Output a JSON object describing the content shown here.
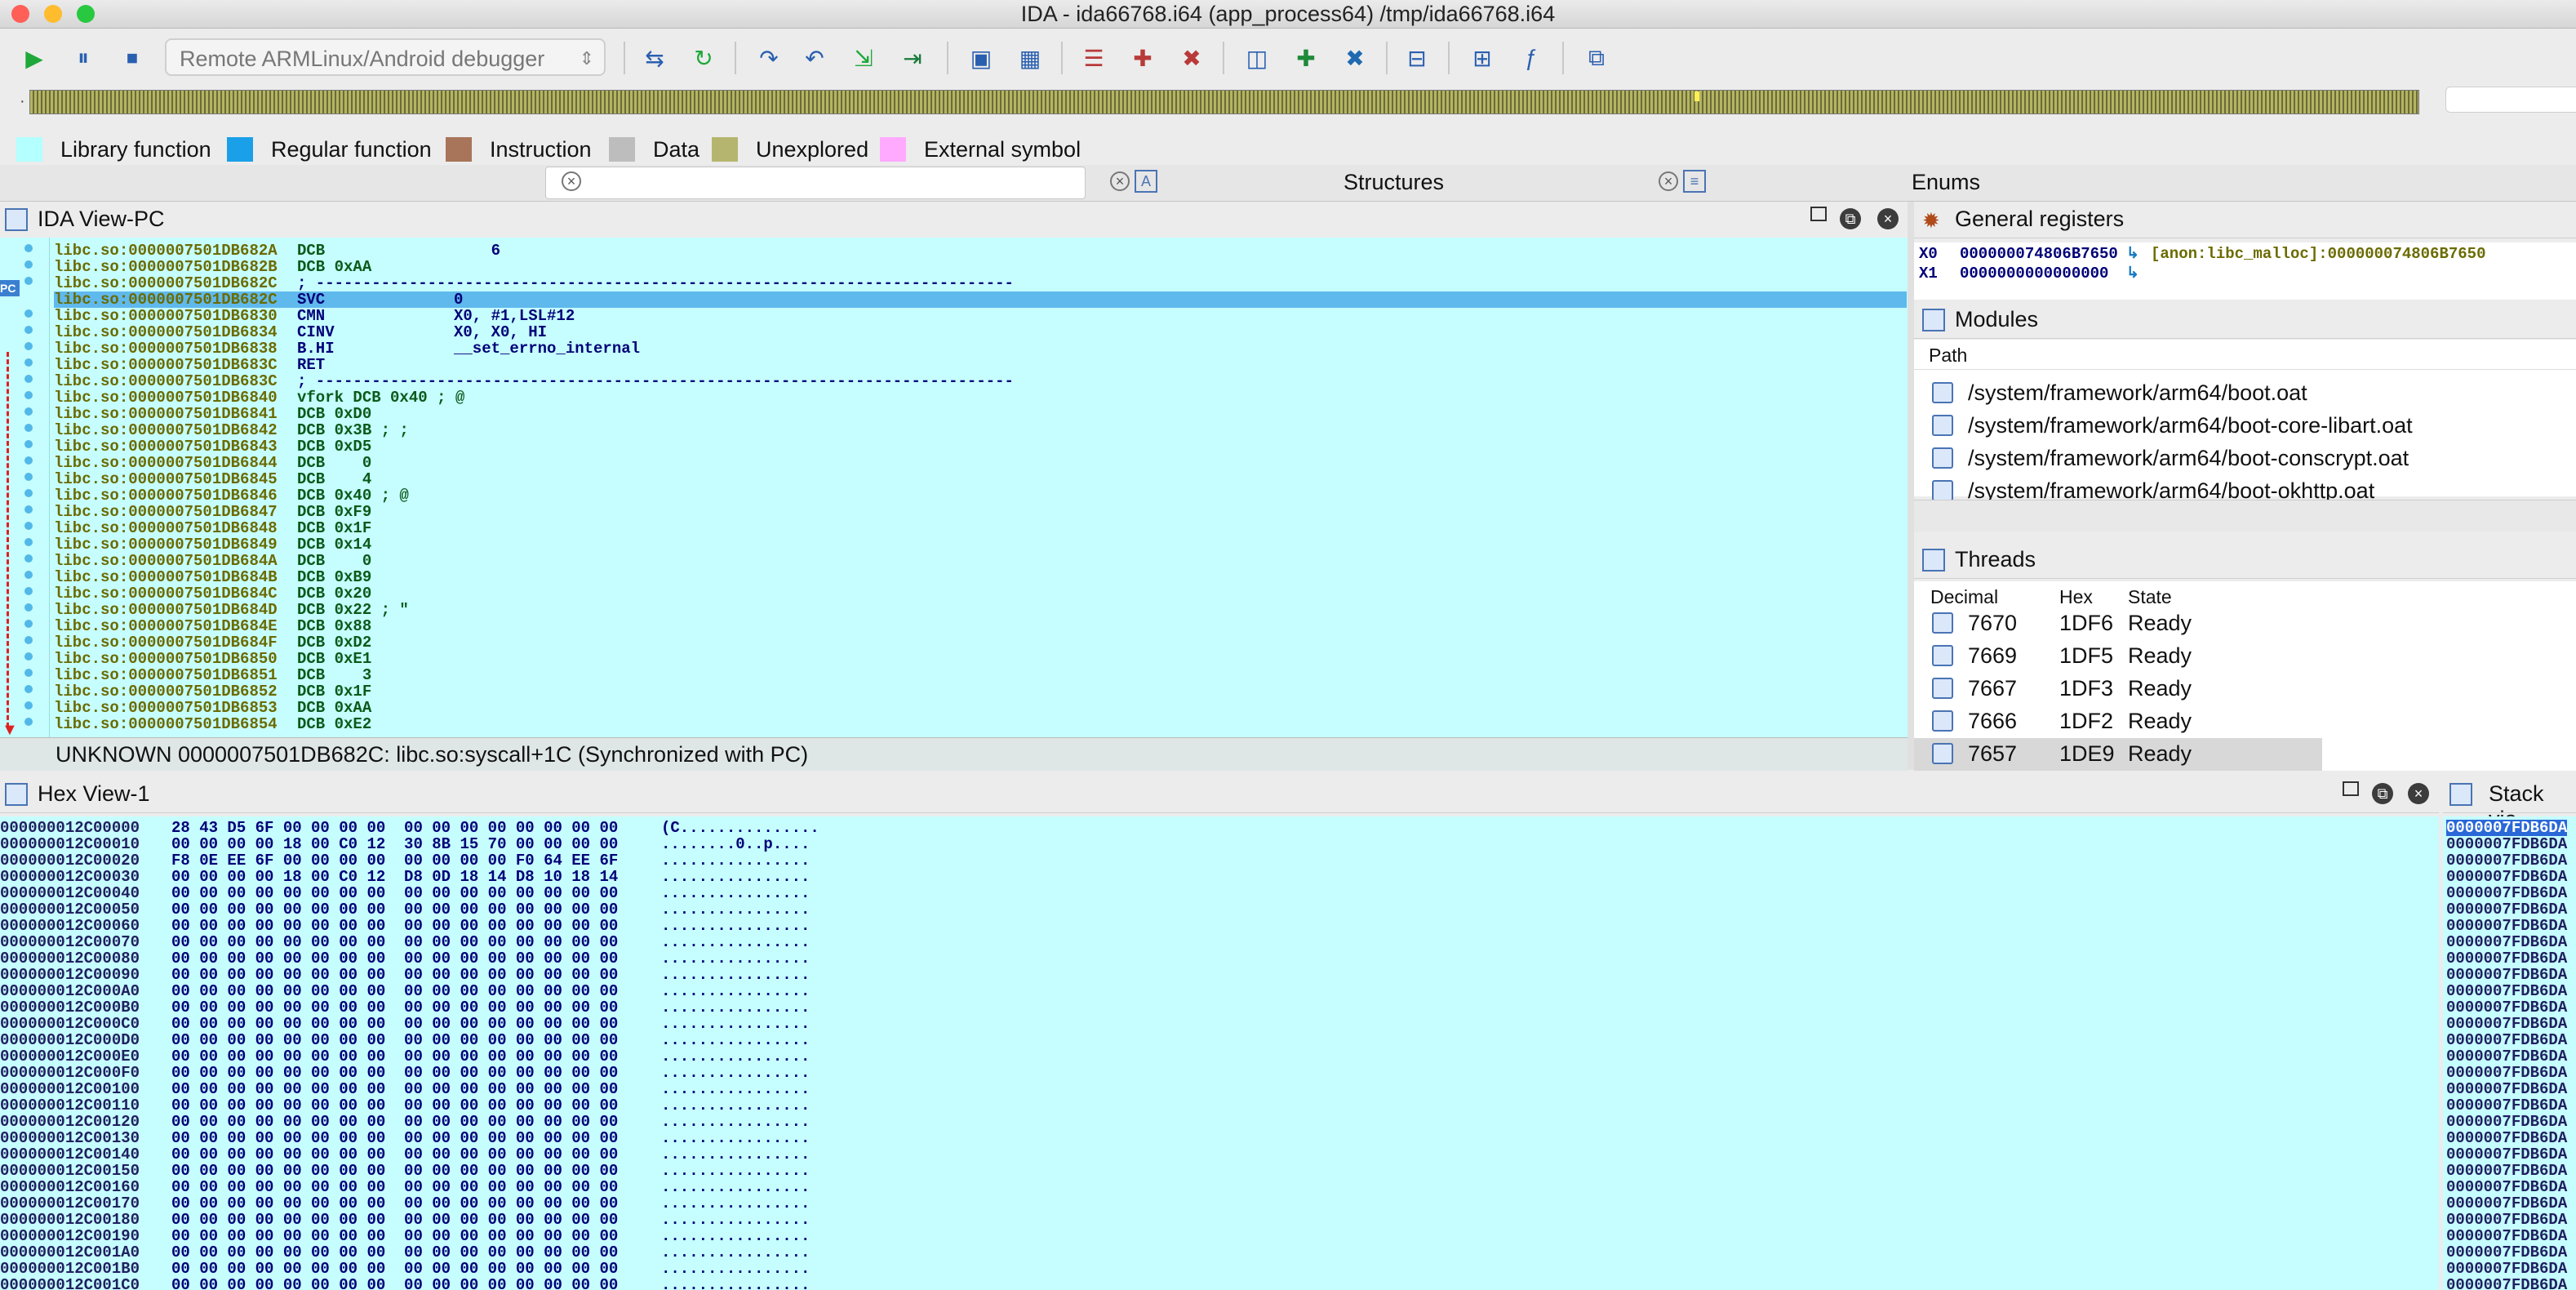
{
  "window": {
    "title": "IDA - ida66768.i64 (app_process64) /tmp/ida66768.i64"
  },
  "toolbar": {
    "debugger": "Remote ARMLinux/Android debugger",
    "icons": [
      "play-icon",
      "pause-icon",
      "stop-icon",
      "attach-icon",
      "step-into-icon",
      "step-over-icon",
      "step-out-icon",
      "run-to-cursor-icon",
      "breakpoint-icon",
      "add-watch-icon",
      "delete-watch-icon",
      "view-icon",
      "regs-icon",
      "list-icon",
      "trace-icon",
      "struct-icon",
      "func-icon",
      "window-icon"
    ]
  },
  "legend": [
    {
      "label": "Library function",
      "color": "#b4ffff"
    },
    {
      "label": "Regular function",
      "color": "#1aa0e8"
    },
    {
      "label": "Instruction",
      "color": "#a8745a"
    },
    {
      "label": "Data",
      "color": "#bdbdbd"
    },
    {
      "label": "Unexplored",
      "color": "#b5b56f"
    },
    {
      "label": "External symbol",
      "color": "#ffaaff"
    }
  ],
  "tabs": {
    "structures": "Structures",
    "enums": "Enums"
  },
  "ida_view": {
    "title": "IDA View-PC",
    "pc_label": "PC",
    "lines": [
      {
        "addr": "libc.so:0000007501DB682A",
        "mn": "DCB",
        "op": "    6"
      },
      {
        "addr": "libc.so:0000007501DB682B",
        "mn": "DCB 0xAA",
        "op": ""
      },
      {
        "addr": "libc.so:0000007501DB682C",
        "mn": "; ---------------------------------------------------------------------------",
        "op": ""
      },
      {
        "addr": "libc.so:0000007501DB682C",
        "mn": "SVC",
        "op": "0",
        "hl": true
      },
      {
        "addr": "libc.so:0000007501DB6830",
        "mn": "CMN",
        "op": "X0, #1,LSL#12"
      },
      {
        "addr": "libc.so:0000007501DB6834",
        "mn": "CINV",
        "op": "X0, X0, HI"
      },
      {
        "addr": "libc.so:0000007501DB6838",
        "mn": "B.HI",
        "op": "__set_errno_internal"
      },
      {
        "addr": "libc.so:0000007501DB683C",
        "mn": "RET",
        "op": ""
      },
      {
        "addr": "libc.so:0000007501DB683C",
        "mn": "; ---------------------------------------------------------------------------",
        "op": ""
      },
      {
        "addr": "libc.so:0000007501DB6840",
        "mn": "vfork DCB 0x40 ; @",
        "op": ""
      },
      {
        "addr": "libc.so:0000007501DB6841",
        "mn": "DCB 0xD0",
        "op": ""
      },
      {
        "addr": "libc.so:0000007501DB6842",
        "mn": "DCB 0x3B ; ;",
        "op": ""
      },
      {
        "addr": "libc.so:0000007501DB6843",
        "mn": "DCB 0xD5",
        "op": ""
      },
      {
        "addr": "libc.so:0000007501DB6844",
        "mn": "DCB    0",
        "op": ""
      },
      {
        "addr": "libc.so:0000007501DB6845",
        "mn": "DCB    4",
        "op": ""
      },
      {
        "addr": "libc.so:0000007501DB6846",
        "mn": "DCB 0x40 ; @",
        "op": ""
      },
      {
        "addr": "libc.so:0000007501DB6847",
        "mn": "DCB 0xF9",
        "op": ""
      },
      {
        "addr": "libc.so:0000007501DB6848",
        "mn": "DCB 0x1F",
        "op": ""
      },
      {
        "addr": "libc.so:0000007501DB6849",
        "mn": "DCB 0x14",
        "op": ""
      },
      {
        "addr": "libc.so:0000007501DB684A",
        "mn": "DCB    0",
        "op": ""
      },
      {
        "addr": "libc.so:0000007501DB684B",
        "mn": "DCB 0xB9",
        "op": ""
      },
      {
        "addr": "libc.so:0000007501DB684C",
        "mn": "DCB 0x20",
        "op": ""
      },
      {
        "addr": "libc.so:0000007501DB684D",
        "mn": "DCB 0x22 ; \"",
        "op": ""
      },
      {
        "addr": "libc.so:0000007501DB684E",
        "mn": "DCB 0x88",
        "op": ""
      },
      {
        "addr": "libc.so:0000007501DB684F",
        "mn": "DCB 0xD2",
        "op": ""
      },
      {
        "addr": "libc.so:0000007501DB6850",
        "mn": "DCB 0xE1",
        "op": ""
      },
      {
        "addr": "libc.so:0000007501DB6851",
        "mn": "DCB    3",
        "op": ""
      },
      {
        "addr": "libc.so:0000007501DB6852",
        "mn": "DCB 0x1F",
        "op": ""
      },
      {
        "addr": "libc.so:0000007501DB6853",
        "mn": "DCB 0xAA",
        "op": ""
      },
      {
        "addr": "libc.so:0000007501DB6854",
        "mn": "DCB 0xE2",
        "op": ""
      }
    ],
    "status": "UNKNOWN  0000007501DB682C: libc.so:syscall+1C  (Synchronized with PC)"
  },
  "registers": {
    "title": "General registers",
    "rows": [
      {
        "name": "X0",
        "value": "000000074806B7650",
        "note": "[anon:libc_malloc]:000000074806B7650"
      },
      {
        "name": "X1",
        "value": "0000000000000000",
        "note": ""
      }
    ]
  },
  "modules": {
    "title": "Modules",
    "column": "Path",
    "rows": [
      "/system/framework/arm64/boot.oat",
      "/system/framework/arm64/boot-core-libart.oat",
      "/system/framework/arm64/boot-conscrypt.oat",
      "/system/framework/arm64/boot-okhttp.oat"
    ]
  },
  "threads": {
    "title": "Threads",
    "columns": [
      "Decimal",
      "Hex",
      "State"
    ],
    "rows": [
      [
        "7670",
        "1DF6",
        "Ready"
      ],
      [
        "7669",
        "1DF5",
        "Ready"
      ],
      [
        "7667",
        "1DF3",
        "Ready"
      ],
      [
        "7666",
        "1DF2",
        "Ready"
      ],
      [
        "7657",
        "1DE9",
        "Ready"
      ]
    ]
  },
  "hex_view": {
    "title": "Hex View-1",
    "rows": [
      [
        "000000012C00000",
        "28 43 D5 6F 00 00 00 00  00 00 00 00 00 00 00 00",
        "(C..............."
      ],
      [
        "000000012C00010",
        "00 00 00 00 18 00 C0 12  30 8B 15 70 00 00 00 00",
        "........0..p...."
      ],
      [
        "000000012C00020",
        "F8 0E EE 6F 00 00 00 00  00 00 00 00 F0 64 EE 6F",
        "................"
      ],
      [
        "000000012C00030",
        "00 00 00 00 18 00 C0 12  D8 0D 18 14 D8 10 18 14",
        "................"
      ],
      [
        "000000012C00040",
        "00 00 00 00 00 00 00 00  00 00 00 00 00 00 00 00",
        "................"
      ],
      [
        "000000012C00050",
        "00 00 00 00 00 00 00 00  00 00 00 00 00 00 00 00",
        "................"
      ],
      [
        "000000012C00060",
        "00 00 00 00 00 00 00 00  00 00 00 00 00 00 00 00",
        "................"
      ],
      [
        "000000012C00070",
        "00 00 00 00 00 00 00 00  00 00 00 00 00 00 00 00",
        "................"
      ],
      [
        "000000012C00080",
        "00 00 00 00 00 00 00 00  00 00 00 00 00 00 00 00",
        "................"
      ],
      [
        "000000012C00090",
        "00 00 00 00 00 00 00 00  00 00 00 00 00 00 00 00",
        "................"
      ],
      [
        "000000012C000A0",
        "00 00 00 00 00 00 00 00  00 00 00 00 00 00 00 00",
        "................"
      ],
      [
        "000000012C000B0",
        "00 00 00 00 00 00 00 00  00 00 00 00 00 00 00 00",
        "................"
      ],
      [
        "000000012C000C0",
        "00 00 00 00 00 00 00 00  00 00 00 00 00 00 00 00",
        "................"
      ],
      [
        "000000012C000D0",
        "00 00 00 00 00 00 00 00  00 00 00 00 00 00 00 00",
        "................"
      ],
      [
        "000000012C000E0",
        "00 00 00 00 00 00 00 00  00 00 00 00 00 00 00 00",
        "................"
      ],
      [
        "000000012C000F0",
        "00 00 00 00 00 00 00 00  00 00 00 00 00 00 00 00",
        "................"
      ],
      [
        "000000012C00100",
        "00 00 00 00 00 00 00 00  00 00 00 00 00 00 00 00",
        "................"
      ],
      [
        "000000012C00110",
        "00 00 00 00 00 00 00 00  00 00 00 00 00 00 00 00",
        "................"
      ],
      [
        "000000012C00120",
        "00 00 00 00 00 00 00 00  00 00 00 00 00 00 00 00",
        "................"
      ],
      [
        "000000012C00130",
        "00 00 00 00 00 00 00 00  00 00 00 00 00 00 00 00",
        "................"
      ],
      [
        "000000012C00140",
        "00 00 00 00 00 00 00 00  00 00 00 00 00 00 00 00",
        "................"
      ],
      [
        "000000012C00150",
        "00 00 00 00 00 00 00 00  00 00 00 00 00 00 00 00",
        "................"
      ],
      [
        "000000012C00160",
        "00 00 00 00 00 00 00 00  00 00 00 00 00 00 00 00",
        "................"
      ],
      [
        "000000012C00170",
        "00 00 00 00 00 00 00 00  00 00 00 00 00 00 00 00",
        "................"
      ],
      [
        "000000012C00180",
        "00 00 00 00 00 00 00 00  00 00 00 00 00 00 00 00",
        "................"
      ],
      [
        "000000012C00190",
        "00 00 00 00 00 00 00 00  00 00 00 00 00 00 00 00",
        "................"
      ],
      [
        "000000012C001A0",
        "00 00 00 00 00 00 00 00  00 00 00 00 00 00 00 00",
        "................"
      ],
      [
        "000000012C001B0",
        "00 00 00 00 00 00 00 00  00 00 00 00 00 00 00 00",
        "................"
      ],
      [
        "000000012C001C0",
        "00 00 00 00 00 00 00 00  00 00 00 00 00 00 00 00",
        "................"
      ]
    ]
  },
  "stack_view": {
    "title": "Stack vie",
    "rows": [
      "0000007FDB6DA",
      "0000007FDB6DA",
      "0000007FDB6DA",
      "0000007FDB6DA",
      "0000007FDB6DA",
      "0000007FDB6DA",
      "0000007FDB6DA",
      "0000007FDB6DA",
      "0000007FDB6DA",
      "0000007FDB6DA",
      "0000007FDB6DA",
      "0000007FDB6DA",
      "0000007FDB6DA",
      "0000007FDB6DA",
      "0000007FDB6DA",
      "0000007FDB6DA",
      "0000007FDB6DA",
      "0000007FDB6DA",
      "0000007FDB6DA",
      "0000007FDB6DA",
      "0000007FDB6DA",
      "0000007FDB6DA",
      "0000007FDB6DA",
      "0000007FDB6DA",
      "0000007FDB6DA",
      "0000007FDB6DA",
      "0000007FDB6DA",
      "0000007FDB6DA",
      "0000007FDB6DA"
    ]
  }
}
